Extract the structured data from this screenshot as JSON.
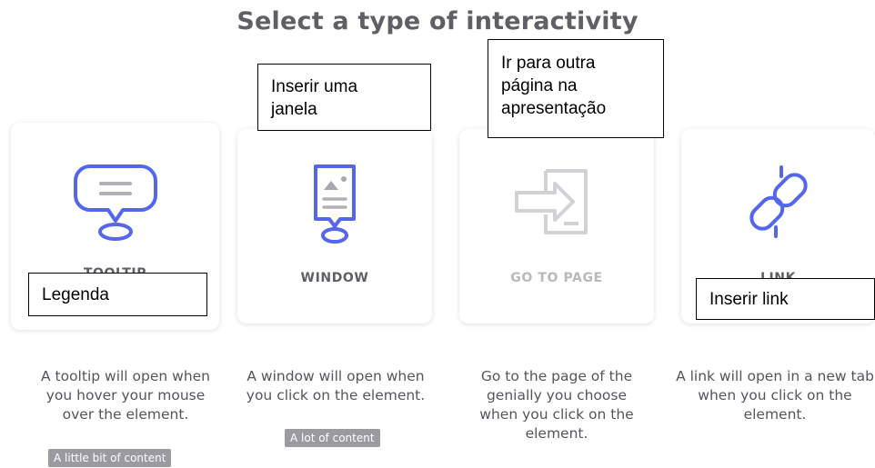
{
  "title": "Select a type of interactivity",
  "accent_color": "#5566ee",
  "disabled_color": "#b8b8bd",
  "cards": [
    {
      "label": "TOOLTIP",
      "icon": "speech-bubble-icon",
      "description": "A tooltip will open when you hover your mouse over the element.",
      "badge": "A little bit of content"
    },
    {
      "label": "WINDOW",
      "icon": "window-document-icon",
      "description": "A window will open when you click on the element.",
      "badge": "A lot of content"
    },
    {
      "label": "GO TO PAGE",
      "icon": "go-to-page-icon",
      "description": "Go to the page of the genially you choose when you click on the element.",
      "badge": ""
    },
    {
      "label": "LINK",
      "icon": "link-icon",
      "description": "A link will open in a new tab when you click on the element.",
      "badge": ""
    }
  ],
  "annotations": {
    "tooltip": "Legenda",
    "window": "Inserir uma janela",
    "goto": "Ir para outra página na apresentação",
    "link": "Inserir link"
  }
}
